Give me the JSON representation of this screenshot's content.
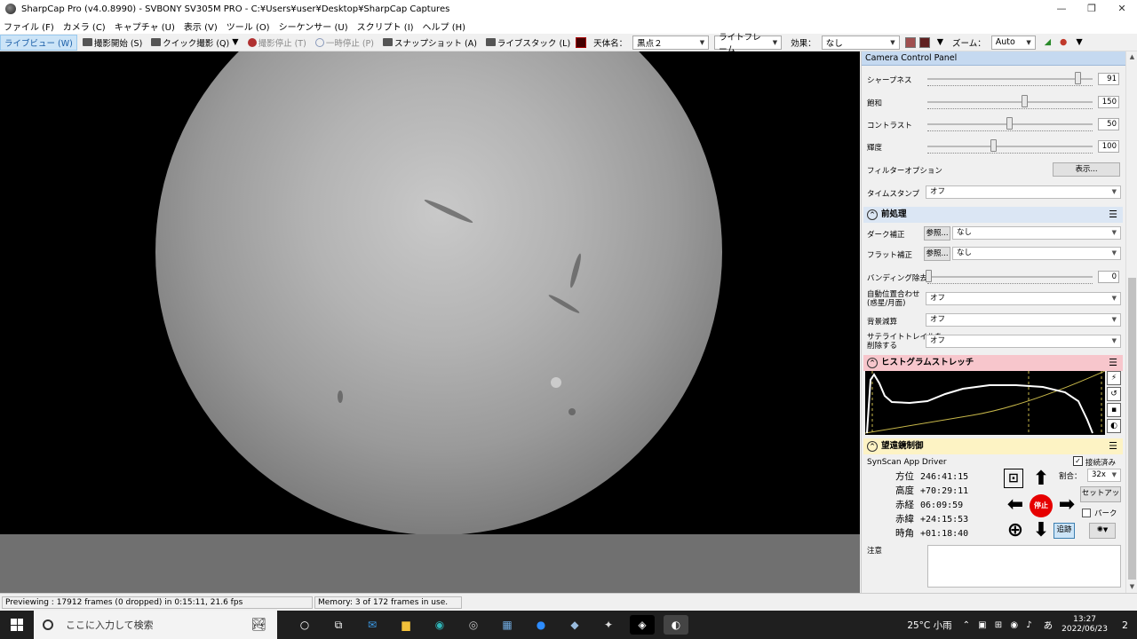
{
  "window": {
    "title": "SharpCap Pro (v4.0.8990) - SVBONY SV305M PRO - C:¥Users¥user¥Desktop¥SharpCap Captures",
    "controls": [
      "—",
      "❐",
      "✕"
    ]
  },
  "menu": [
    "ファイル (F)",
    "カメラ (C)",
    "キャプチャ (U)",
    "表示 (V)",
    "ツール (O)",
    "シーケンサー (U)",
    "スクリプト (I)",
    "ヘルプ (H)"
  ],
  "toolbar": {
    "live_view": "ライブビュー (W)",
    "start_capture": "撮影開始 (S)",
    "quick_capture": "クイック撮影 (Q)",
    "stop_capture": "撮影停止 (T)",
    "pause": "一時停止 (P)",
    "snapshot": "スナップショット (A)",
    "live_stack": "ライブスタック (L)",
    "target_label": "天体名：",
    "target_value": "黒点２",
    "frame_type": "ライトフレーム",
    "effect_label": "効果：",
    "effect_value": "なし",
    "zoom_label": "ズーム：",
    "zoom_value": "Auto"
  },
  "camera_panel": {
    "title": "Camera Control Panel",
    "sharpness_label": "シャープネス",
    "sharpness_value": "91",
    "saturation_label": "飽和",
    "saturation_value": "150",
    "contrast_label": "コントラスト",
    "contrast_value": "50",
    "brightness_label": "輝度",
    "brightness_value": "100",
    "filter_label": "フィルターオプション",
    "filter_button": "表示...",
    "timestamp_label": "タイムスタンプ",
    "timestamp_value": "オフ"
  },
  "preprocessing": {
    "title": "前処理",
    "dark_label": "ダーク補正",
    "dark_browse": "参照...",
    "dark_value": "なし",
    "flat_label": "フラット補正",
    "flat_browse": "参照...",
    "flat_value": "なし",
    "banding_label": "バンディング除去",
    "banding_value": "0",
    "align_label_1": "自動位置合わせ",
    "align_label_2": "(惑星/月面)",
    "align_value": "オフ",
    "bg_label": "背景減算",
    "bg_value": "オフ",
    "sat_label_1": "サテライトトレイルを",
    "sat_label_2": "削除する",
    "sat_value": "オフ"
  },
  "histogram": {
    "title": "ヒストグラムストレッチ",
    "header_color": "#f7c6cc"
  },
  "telescope": {
    "title": "望遠鏡制御",
    "header_color": "#fdf3c4",
    "driver": "SynScan App Driver",
    "connected_label": "接続済み",
    "connected": true,
    "azimuth_label": "方位",
    "azimuth": "246:41:15",
    "altitude_label": "高度",
    "altitude": "+70:29:11",
    "ra_label": "赤経",
    "ra": "06:09:59",
    "dec_label": "赤緯",
    "dec": "+24:15:53",
    "hour_angle_label": "時角",
    "hour_angle": "+01:18:40",
    "rate_label": "割合：",
    "rate_value": "32x",
    "stop_label": "停止",
    "setup_button": "セットアップ",
    "park_label": "パーク",
    "tracking_button": "追跡",
    "notes_label": "注意",
    "stop_color": "#e60000"
  },
  "status": {
    "preview": "Previewing : 17912 frames (0 dropped) in 0:15:11, 21.6 fps",
    "memory": "Memory: 3 of 172 frames in use."
  },
  "taskbar": {
    "search_placeholder": "ここに入力して検索",
    "weather": "25°C 小雨",
    "ime": "あ",
    "time": "13:27",
    "date": "2022/06/23",
    "notifications": "2"
  }
}
